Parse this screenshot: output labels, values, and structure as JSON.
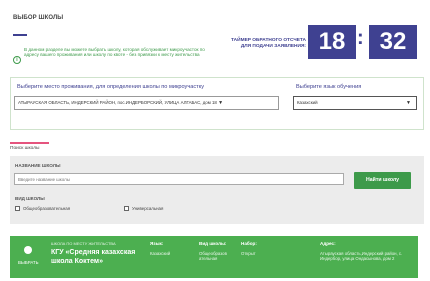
{
  "header": {
    "title": "ВЫБОР ШКОЛЫ",
    "info_icon": "info-icon",
    "info_lines": [
      "В данном разделе вы можете выбрать школу, которая обслуживает микроучасток по",
      "адресу вашего проживания или школу по квоте - без привязки к месту жительства"
    ]
  },
  "timer": {
    "label_line1": "ТАЙМЕР ОБРАТНОГО ОТСЧЕТА",
    "label_line2": "ДЛЯ ПОДАЧИ ЗАЯВЛЕНИЯ:",
    "minutes": "18",
    "colon": ":",
    "seconds": "32"
  },
  "location": {
    "place_label": "Выберите место проживания, для определения школы по микроучастку",
    "place_value": "АТЫРАУСКАЯ ОБЛАСТЬ, ИНДЕРСКИЙ РАЙОН, пос.ИНДЕРБОРСКИЙ, УЛИЦА АЛГАБАС, дом 18",
    "lang_label": "Выберите язык обучения",
    "lang_value": "Казахский",
    "arrow": "▼"
  },
  "search": {
    "tab_label": "Поиск школы",
    "name_label": "НАЗВАНИЕ ШКОЛЫ",
    "name_placeholder": "Введите название школы",
    "find_button": "Найти школу",
    "type_label": "ВИД ШКОЛЫ",
    "checkboxes": [
      "Общеобразовательная",
      "Универсальная"
    ]
  },
  "result": {
    "choose_label": "ВЫБРАТЬ",
    "small_label": "ШКОЛА ПО МЕСТУ ЖИТЕЛЬСТВА",
    "school_name": "КГУ «Средняя казахская школа Коктем»",
    "lang_header": "Язык:",
    "lang_value": "Казахский",
    "type_header": "Вид школы:",
    "type_value": "Общеобразов ательная",
    "enroll_header": "Набор:",
    "enroll_value": "Открыт",
    "address_header": "Адрес:",
    "address_value": "Атырауская область,Индерский район, с. Индербор, улица Ондасынова, дом 2"
  }
}
